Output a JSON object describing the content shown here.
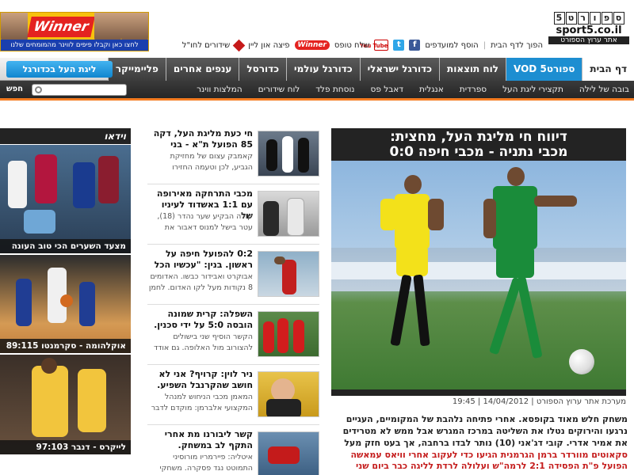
{
  "banner": {
    "logo_text": "Winner",
    "strip_text": "לחצו כאן וקבלו פיפים לווינר מהמומחים שלנו"
  },
  "site": {
    "logo_digits": [
      "5",
      "ט",
      "ר",
      "ו",
      "פ",
      "ס"
    ],
    "logo_domain": "sport5.co.il",
    "logo_tagline": "אתר ערוץ הספורט"
  },
  "toplinks": {
    "homepage": "הפוך לדף הבית",
    "favorites": "הוסף למועדפים",
    "facebook_icon": "f",
    "twitter_icon": "t",
    "youtube_icon": "You Tube",
    "send_tofes": "שלח טופס",
    "winner_link": "Winner",
    "pizza": "פיצה און ליין",
    "broadcasts": "שידורים לחו\"ל"
  },
  "mainnav": {
    "items": [
      "דף הבית",
      "ספורט5 VOD",
      "לוח תוצאות",
      "כדורגל ישראלי",
      "כדורגל עולמי",
      "כדורסל",
      "ענפים אחרים",
      "פליימייקר"
    ],
    "live_button": "ליגת העל בכדורגל"
  },
  "subnav": {
    "items": [
      "בובה של לילה",
      "תקצירי ליגת העל",
      "ספרדית",
      "אנגלית",
      "דאבל פס",
      "נוסחת פלד",
      "לוח שידורים",
      "המלצות ווינר"
    ],
    "search_label": "חפש",
    "search_placeholder": ""
  },
  "hero": {
    "title_line1": "דיווח חי מליגת העל, מחצית:",
    "title_line2": "מכבי נתניה - מכבי חיפה 0:0",
    "meta": "מערכת אתר ערוץ הספורט | 14/04/2012 | 19:45",
    "body": "משחק חלש מאוד בקופסא. אחרי פתיחה נלהבת של המקומיים, העגיים נרגעו והירוקים נטלו את השליטה במרכז המגרש אבל ממש לא מטרידים את אמיר אדרי. קובי דג'אני (10) נותר לבדו ברחבה, אך בעט חזק מעל",
    "bullets": [
      "סקאוטים מוורדר ברמן הגרמנית הגיעו כדי לעקוב אחרי וויאס עמאשה",
      "הפועל פ\"ת הפסידה 2:1 לרמה\"ש ועלולה לרדת לליגה כבר ביום שני"
    ]
  },
  "news": [
    {
      "title": "חי כעת מליגת העל, דקה 85 הפועל ת\"א - בני",
      "sub": "קאמבק עצום של מחזיקת הגביע, לכן וטעמה החזירו"
    },
    {
      "title": "מכבי התרחקה מאירופה עם 1:1 באשדוד לעיניו של",
      "sub": "קולה הבקיע שער נהדר (18), עטר בישל למנוס דאבור את"
    },
    {
      "title": "0:2 להפועל חיפה על ראשון. בנין: \"עכשיו הכל",
      "sub": "אבוקרט ואבידור כבשו. האדומים 8 נקודות מעל לקו האדום. לחמן"
    },
    {
      "title": "השפלה: קרית שמונה הובסה 5:0 על ידי סכנין.",
      "sub": "הקשר הוסיף שני בישולים להצורוב מול האלופה. גם אודד"
    },
    {
      "title": "ניר לוין: קרויף? אני לא חושב שהקרנבל השפיע.",
      "sub": "המאמן מכבי הניחוש למנהל המקצועי אלברמן: מוקדם לדבר"
    },
    {
      "title": "קשר ליבורנו מת אחרי התקף לב במשחק.",
      "sub": "איטליה: פיירמריו מורוסיני התמוטט נגד פסקרה. משחקי"
    }
  ],
  "video": {
    "header": "וידאו",
    "items": [
      {
        "caption": "מצעד השערים הכי טוב העונה"
      },
      {
        "caption": "אוקלהומה - סקרמנטו 89:115"
      },
      {
        "caption": "לייקרס - דנבר 97:103"
      }
    ]
  },
  "colors": {
    "accent_blue": "#1d8ed1",
    "accent_orange": "#f47b20",
    "bullet_red": "#c41b1b",
    "dark_header": "#232323"
  }
}
